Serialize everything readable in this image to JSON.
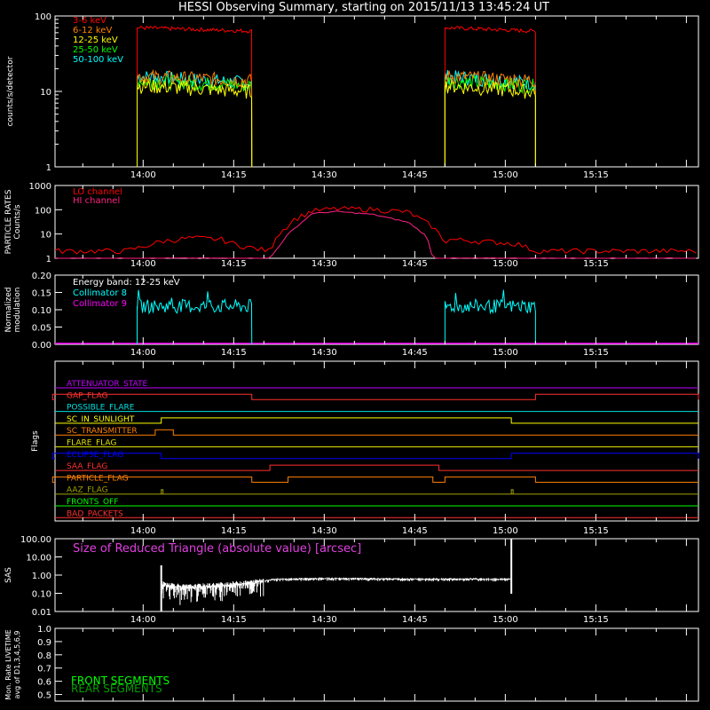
{
  "title": "HESSI Observing Summary, starting on 2015/11/13 13:45:24 UT",
  "time_axis": {
    "ticks": [
      "14:00",
      "14:15",
      "14:30",
      "14:45",
      "15:00",
      "15:15"
    ]
  },
  "chart_data": [
    {
      "type": "line",
      "name": "counts",
      "ylabel": "counts/s/detector",
      "yscale": "log",
      "ylim": [
        1,
        100
      ],
      "yticks": [
        "1",
        "10",
        "100"
      ],
      "series": [
        {
          "name": "3-6 keV",
          "color": "#ff0000"
        },
        {
          "name": "6-12 keV",
          "color": "#ff8000"
        },
        {
          "name": "12-25 keV",
          "color": "#ffff00"
        },
        {
          "name": "25-50 keV",
          "color": "#00ff00"
        },
        {
          "name": "50-100 keV",
          "color": "#00ffff"
        }
      ],
      "levels": {
        "3-6 keV": [
          63,
          70
        ],
        "6-12 keV": [
          14,
          16
        ],
        "12-25 keV": [
          10,
          12
        ],
        "25-50 keV": [
          12,
          14
        ],
        "50-100 keV": [
          13,
          16
        ]
      },
      "intervals": [
        [
          "13:59",
          "14:18"
        ],
        [
          "14:50",
          "15:05"
        ]
      ]
    },
    {
      "type": "line",
      "name": "particle",
      "ylabel": "PARTICLE RATES Counts/s",
      "yscale": "log",
      "ylim": [
        1,
        1000
      ],
      "yticks": [
        "1",
        "10",
        "100",
        "1000"
      ],
      "series": [
        {
          "name": "LO channel",
          "color": "#ff0000"
        },
        {
          "name": "HI channel",
          "color": "#ff2080"
        }
      ],
      "lo_channel": [
        [
          "13:45",
          2
        ],
        [
          "13:57",
          2
        ],
        [
          "14:00",
          3
        ],
        [
          "14:03",
          5
        ],
        [
          "14:08",
          7
        ],
        [
          "14:13",
          6
        ],
        [
          "14:15",
          4
        ],
        [
          "14:17",
          3
        ],
        [
          "14:21",
          2
        ],
        [
          "14:22",
          8
        ],
        [
          "14:25",
          40
        ],
        [
          "14:28",
          90
        ],
        [
          "14:32",
          110
        ],
        [
          "14:38",
          105
        ],
        [
          "14:44",
          80
        ],
        [
          "14:48",
          20
        ],
        [
          "14:50",
          5
        ],
        [
          "14:51",
          6
        ],
        [
          "15:02",
          4
        ],
        [
          "15:05",
          2
        ],
        [
          "15:32",
          2
        ]
      ],
      "hi_channel": [
        [
          "13:45",
          1
        ],
        [
          "14:21",
          1
        ],
        [
          "14:24",
          10
        ],
        [
          "14:28",
          70
        ],
        [
          "14:32",
          85
        ],
        [
          "14:38",
          65
        ],
        [
          "14:44",
          30
        ],
        [
          "14:47",
          8
        ],
        [
          "14:48",
          1
        ],
        [
          "15:32",
          1
        ]
      ]
    },
    {
      "type": "line",
      "name": "modulation",
      "ylabel": "Normalized modulation",
      "ylim": [
        0,
        0.2
      ],
      "yticks": [
        "0.00",
        "0.05",
        "0.10",
        "0.15",
        "0.20"
      ],
      "annotation": "Energy band: 12-25 keV",
      "series": [
        {
          "name": "Collimator 8",
          "color": "#00ffff",
          "level": 0.11
        },
        {
          "name": "Collimator 9",
          "color": "#ff00ff",
          "level": 0.0
        }
      ],
      "intervals": [
        [
          "13:59",
          "14:18"
        ],
        [
          "14:50",
          "15:05"
        ]
      ]
    },
    {
      "type": "line",
      "name": "flags",
      "ylabel": "Flags",
      "series": [
        {
          "name": "ATTENUATOR_STATE",
          "color": "#c000ff",
          "highs": []
        },
        {
          "name": "GAP_FLAG",
          "color": "#ff3030",
          "highs": [
            [
              "13:45",
              "14:18"
            ],
            [
              "15:05",
              "15:32"
            ]
          ]
        },
        {
          "name": "POSSIBLE_FLARE",
          "color": "#00e0e0",
          "highs": []
        },
        {
          "name": "SC_IN_SUNLIGHT",
          "color": "#ffff00",
          "highs": [
            [
              "14:03",
              "15:01"
            ]
          ]
        },
        {
          "name": "SC_TRANSMITTER",
          "color": "#ff8000",
          "highs": [
            [
              "14:02",
              "14:05"
            ]
          ]
        },
        {
          "name": "FLARE_FLAG",
          "color": "#e0e000",
          "highs": []
        },
        {
          "name": "ECLIPSE_FLAG",
          "color": "#0000ff",
          "highs": [
            [
              "13:45",
              "14:03"
            ],
            [
              "15:01",
              "15:32"
            ]
          ]
        },
        {
          "name": "SAA_FLAG",
          "color": "#ff3030",
          "highs": [
            [
              "14:21",
              "14:49"
            ]
          ]
        },
        {
          "name": "PARTICLE_FLAG",
          "color": "#ff8000",
          "highs": [
            [
              "13:45",
              "14:18"
            ],
            [
              "14:24",
              "14:48"
            ],
            [
              "14:50",
              "15:05"
            ]
          ]
        },
        {
          "name": "AAZ_FLAG",
          "color": "#a0a000",
          "highs": []
        },
        {
          "name": "FRONTS_OFF",
          "color": "#00ff00",
          "highs": []
        },
        {
          "name": "BAD_PACKETS",
          "color": "#ff3030",
          "highs": []
        }
      ]
    },
    {
      "type": "line",
      "name": "sas",
      "ylabel": "SAS",
      "yscale": "log",
      "ylim": [
        0.01,
        100
      ],
      "yticks": [
        "0.01",
        "0.10",
        "1.00",
        "10.00",
        "100.00"
      ],
      "annotation": "Size of Reduced Triangle (absolute value) [arcsec]",
      "series": [
        {
          "name": "",
          "color": "#ffffff"
        }
      ],
      "curve": [
        [
          "14:03",
          0.3
        ],
        [
          "14:07",
          0.2
        ],
        [
          "14:12",
          0.25
        ],
        [
          "14:18",
          0.35
        ],
        [
          "14:22",
          0.6
        ],
        [
          "14:30",
          0.65
        ],
        [
          "14:45",
          0.6
        ],
        [
          "15:01",
          0.6
        ]
      ]
    },
    {
      "type": "line",
      "name": "livetime",
      "ylabel": "Mon. Rate LIVETIME avg of D1,3,4,5,6,9",
      "ylim": [
        0,
        1.0
      ],
      "yticks": [
        "0.5",
        "0.6",
        "0.7",
        "0.8",
        "0.9",
        "1.0"
      ],
      "series": [
        {
          "name": "FRONT SEGMENTS",
          "color": "#00ff00"
        },
        {
          "name": "REAR SEGMENTS",
          "color": "#00a000"
        }
      ]
    }
  ],
  "colors": {
    "background": "#000000",
    "axes": "#ffffff"
  }
}
